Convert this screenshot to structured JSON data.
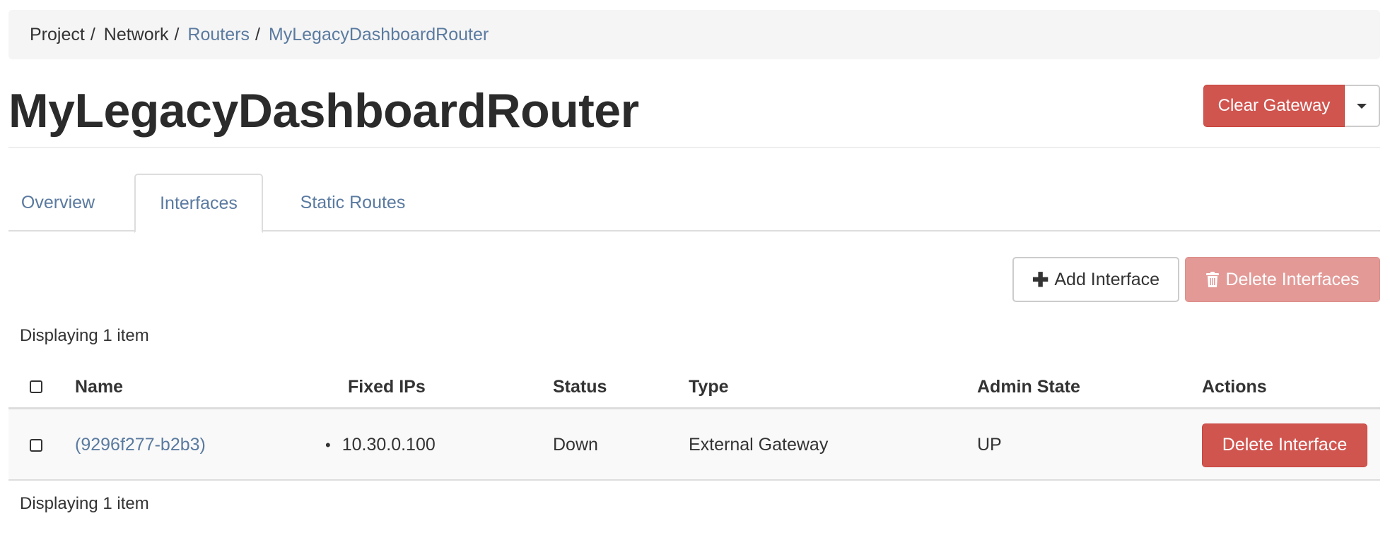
{
  "breadcrumb": {
    "items": [
      {
        "label": "Project",
        "link": false
      },
      {
        "label": "Network",
        "link": false
      },
      {
        "label": "Routers",
        "link": true
      },
      {
        "label": "MyLegacyDashboardRouter",
        "link": true
      }
    ],
    "separator": "/"
  },
  "header": {
    "title": "MyLegacyDashboardRouter",
    "clear_gateway_label": "Clear Gateway"
  },
  "tabs": [
    {
      "label": "Overview",
      "active": false
    },
    {
      "label": "Interfaces",
      "active": true
    },
    {
      "label": "Static Routes",
      "active": false
    }
  ],
  "table_actions": {
    "add_interface_label": "Add Interface",
    "delete_interfaces_label": "Delete Interfaces"
  },
  "count_text_top": "Displaying 1 item",
  "count_text_bottom": "Displaying 1 item",
  "table": {
    "columns": [
      "Name",
      "Fixed IPs",
      "Status",
      "Type",
      "Admin State",
      "Actions"
    ],
    "rows": [
      {
        "name": "(9296f277-b2b3)",
        "fixed_ips": "10.30.0.100",
        "status": "Down",
        "type": "External Gateway",
        "admin_state": "UP",
        "action_label": "Delete Interface"
      }
    ]
  },
  "colors": {
    "danger": "#d0554f",
    "danger_disabled": "#e39a97",
    "link": "#5a7aa0"
  },
  "icons": {
    "add": "plus-icon",
    "delete": "trash-icon",
    "dropdown": "caret-down-icon"
  }
}
